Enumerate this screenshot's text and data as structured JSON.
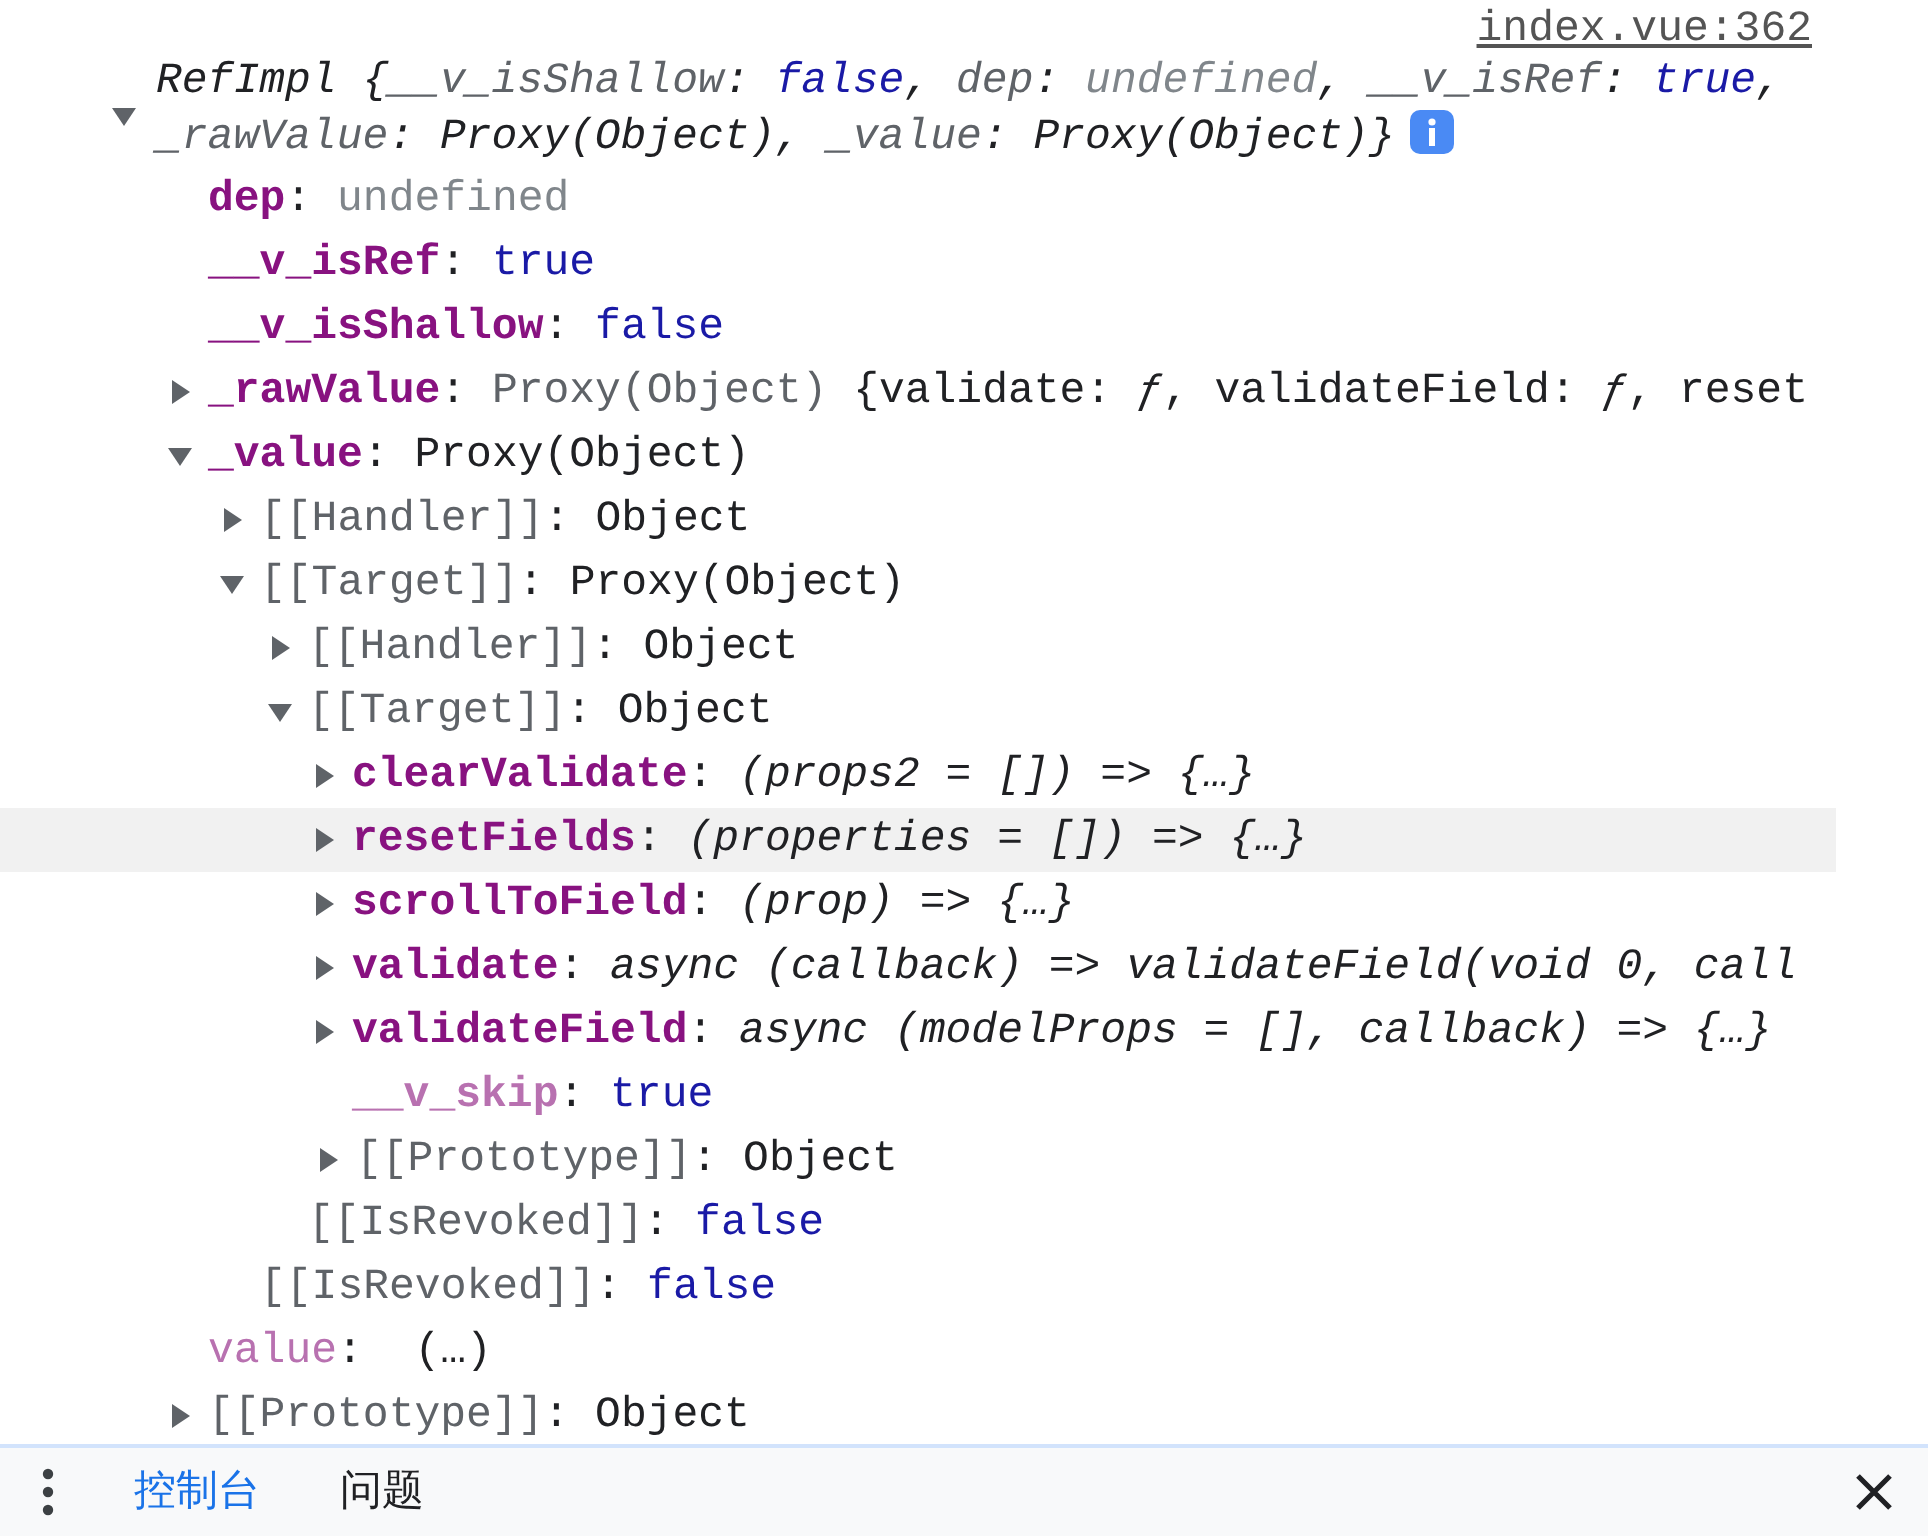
{
  "source_link": "index.vue:362",
  "summary": {
    "expanded": true,
    "lines": [
      [
        {
          "text": "RefImpl",
          "kind": "name"
        },
        {
          "text": " {",
          "kind": "punct"
        },
        {
          "text": "__v_isShallow",
          "kind": "key"
        },
        {
          "text": ": ",
          "kind": "punct"
        },
        {
          "text": "false",
          "kind": "boolean"
        },
        {
          "text": ", ",
          "kind": "punct"
        },
        {
          "text": "dep",
          "kind": "key"
        },
        {
          "text": ": ",
          "kind": "punct"
        },
        {
          "text": "undefined",
          "kind": "undefined"
        },
        {
          "text": ", ",
          "kind": "punct"
        },
        {
          "text": "__v_isRef",
          "kind": "key"
        },
        {
          "text": ": ",
          "kind": "punct"
        },
        {
          "text": "true",
          "kind": "boolean"
        },
        {
          "text": ",",
          "kind": "punct"
        }
      ],
      [
        {
          "text": "_rawValue",
          "kind": "key"
        },
        {
          "text": ": ",
          "kind": "punct"
        },
        {
          "text": "Proxy(Object)",
          "kind": "object"
        },
        {
          "text": ", ",
          "kind": "punct"
        },
        {
          "text": "_value",
          "kind": "key"
        },
        {
          "text": ": ",
          "kind": "punct"
        },
        {
          "text": "Proxy(Object)",
          "kind": "object"
        },
        {
          "text": "}",
          "kind": "punct"
        }
      ]
    ]
  },
  "rows": [
    {
      "kind": "leaf",
      "key": {
        "text": "dep",
        "kind": "own"
      },
      "value": [
        {
          "text": ": ",
          "kind": "punct"
        },
        {
          "text": "undefined",
          "kind": "undefined"
        }
      ]
    },
    {
      "kind": "leaf",
      "key": {
        "text": "__v_isRef",
        "kind": "own"
      },
      "value": [
        {
          "text": ": ",
          "kind": "punct"
        },
        {
          "text": "true",
          "kind": "boolean"
        }
      ]
    },
    {
      "kind": "leaf",
      "key": {
        "text": "__v_isShallow",
        "kind": "own"
      },
      "value": [
        {
          "text": ": ",
          "kind": "punct"
        },
        {
          "text": "false",
          "kind": "boolean"
        }
      ]
    },
    {
      "kind": "node",
      "expanded": false,
      "key": {
        "text": "_rawValue",
        "kind": "own"
      },
      "value": [
        {
          "text": ": ",
          "kind": "punct"
        },
        {
          "text": "Proxy(Object)",
          "kind": "preview"
        },
        {
          "text": " {validate: ",
          "kind": "object"
        },
        {
          "text": "ƒ",
          "kind": "function"
        },
        {
          "text": ", validateField: ",
          "kind": "object"
        },
        {
          "text": "ƒ",
          "kind": "function"
        },
        {
          "text": ", reset",
          "kind": "object"
        }
      ]
    },
    {
      "kind": "node",
      "expanded": true,
      "key": {
        "text": "_value",
        "kind": "own"
      },
      "value": [
        {
          "text": ": ",
          "kind": "punct"
        },
        {
          "text": "Proxy(Object)",
          "kind": "object"
        }
      ],
      "children": [
        {
          "kind": "node",
          "expanded": false,
          "key": {
            "text": "[[Handler]]",
            "kind": "internal"
          },
          "value": [
            {
              "text": ": ",
              "kind": "punct"
            },
            {
              "text": "Object",
              "kind": "object"
            }
          ]
        },
        {
          "kind": "node",
          "expanded": true,
          "key": {
            "text": "[[Target]]",
            "kind": "internal"
          },
          "value": [
            {
              "text": ": ",
              "kind": "punct"
            },
            {
              "text": "Proxy(Object)",
              "kind": "object"
            }
          ],
          "children": [
            {
              "kind": "node",
              "expanded": false,
              "key": {
                "text": "[[Handler]]",
                "kind": "internal"
              },
              "value": [
                {
                  "text": ": ",
                  "kind": "punct"
                },
                {
                  "text": "Object",
                  "kind": "object"
                }
              ]
            },
            {
              "kind": "node",
              "expanded": true,
              "key": {
                "text": "[[Target]]",
                "kind": "internal"
              },
              "value": [
                {
                  "text": ": ",
                  "kind": "punct"
                },
                {
                  "text": "Object",
                  "kind": "object"
                }
              ],
              "children": [
                {
                  "kind": "node",
                  "expanded": false,
                  "hovered": false,
                  "key": {
                    "text": "clearValidate",
                    "kind": "own"
                  },
                  "value": [
                    {
                      "text": ": ",
                      "kind": "punct"
                    },
                    {
                      "text": "(props2 = []) => {…}",
                      "kind": "function"
                    }
                  ]
                },
                {
                  "kind": "node",
                  "expanded": false,
                  "hovered": true,
                  "key": {
                    "text": "resetFields",
                    "kind": "own"
                  },
                  "value": [
                    {
                      "text": ": ",
                      "kind": "punct"
                    },
                    {
                      "text": "(properties = []) => {…}",
                      "kind": "function"
                    }
                  ]
                },
                {
                  "kind": "node",
                  "expanded": false,
                  "hovered": false,
                  "key": {
                    "text": "scrollToField",
                    "kind": "own"
                  },
                  "value": [
                    {
                      "text": ": ",
                      "kind": "punct"
                    },
                    {
                      "text": "(prop) => {…}",
                      "kind": "function"
                    }
                  ]
                },
                {
                  "kind": "node",
                  "expanded": false,
                  "hovered": false,
                  "key": {
                    "text": "validate",
                    "kind": "own"
                  },
                  "value": [
                    {
                      "text": ": ",
                      "kind": "punct"
                    },
                    {
                      "text": "async (callback) => validateField(void 0, call",
                      "kind": "function"
                    }
                  ]
                },
                {
                  "kind": "node",
                  "expanded": false,
                  "hovered": false,
                  "key": {
                    "text": "validateField",
                    "kind": "own"
                  },
                  "value": [
                    {
                      "text": ": ",
                      "kind": "punct"
                    },
                    {
                      "text": "async (modelProps = [], callback) => {…}",
                      "kind": "function"
                    }
                  ]
                },
                {
                  "kind": "leaf",
                  "hovered": false,
                  "key": {
                    "text": "__v_skip",
                    "kind": "hidden"
                  },
                  "value": [
                    {
                      "text": ": ",
                      "kind": "punct"
                    },
                    {
                      "text": "true",
                      "kind": "boolean"
                    }
                  ]
                },
                {
                  "kind": "node",
                  "expanded": false,
                  "hovered": false,
                  "key": {
                    "text": "[[Prototype]]",
                    "kind": "internal"
                  },
                  "value": [
                    {
                      "text": ": ",
                      "kind": "punct"
                    },
                    {
                      "text": "Object",
                      "kind": "object"
                    }
                  ]
                }
              ]
            },
            {
              "kind": "leaf",
              "key": {
                "text": "[[IsRevoked]]",
                "kind": "internal"
              },
              "value": [
                {
                  "text": ": ",
                  "kind": "punct"
                },
                {
                  "text": "false",
                  "kind": "boolean"
                }
              ]
            }
          ]
        },
        {
          "kind": "leaf",
          "key": {
            "text": "[[IsRevoked]]",
            "kind": "internal"
          },
          "value": [
            {
              "text": ": ",
              "kind": "punct"
            },
            {
              "text": "false",
              "kind": "boolean"
            }
          ]
        }
      ]
    },
    {
      "kind": "leaf",
      "key": {
        "text": "value",
        "kind": "accessor"
      },
      "value": [
        {
          "text": ":  ",
          "kind": "punct"
        },
        {
          "text": "(…)",
          "kind": "object"
        }
      ]
    },
    {
      "kind": "node",
      "expanded": false,
      "key": {
        "text": "[[Prototype]]",
        "kind": "internal"
      },
      "value": [
        {
          "text": ": ",
          "kind": "punct"
        },
        {
          "text": "Object",
          "kind": "object"
        }
      ]
    }
  ],
  "tabs": [
    {
      "label": "控制台",
      "selected": true
    },
    {
      "label": "问题",
      "selected": false
    }
  ]
}
